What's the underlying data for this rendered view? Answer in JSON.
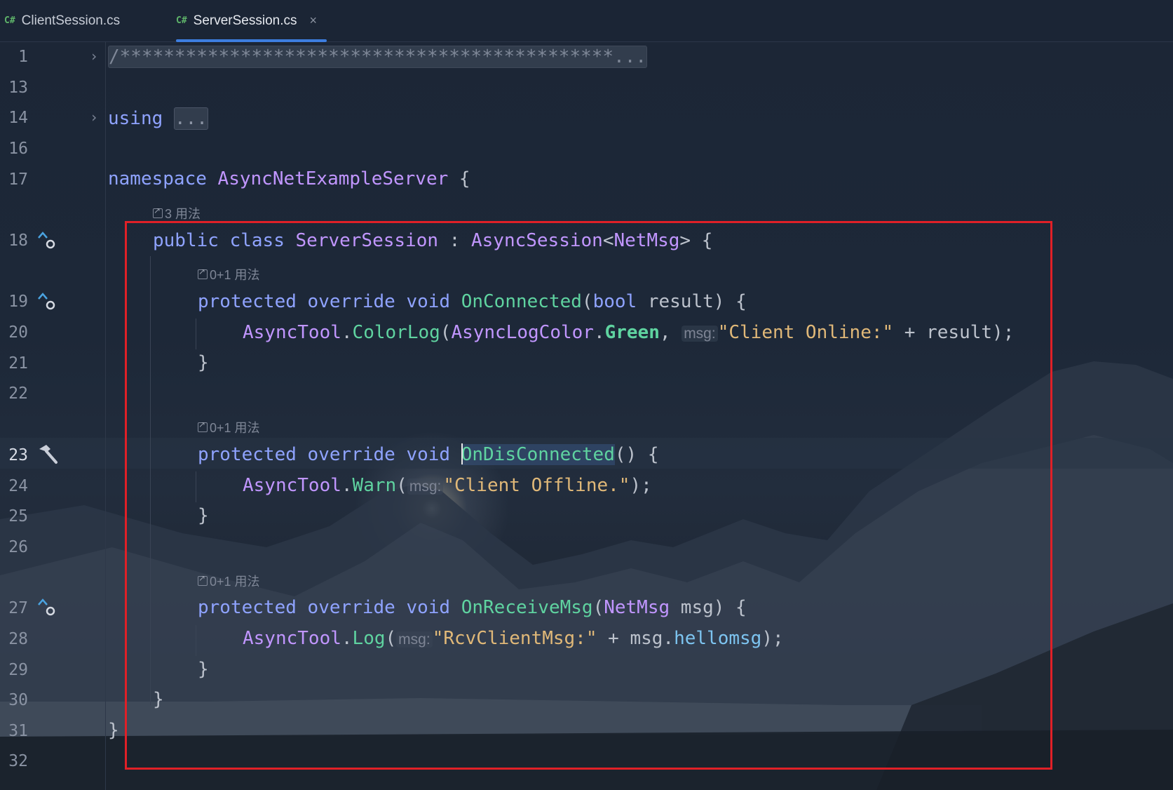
{
  "tabs": [
    {
      "icon": "C#",
      "label": "ClientSession.cs",
      "active": false
    },
    {
      "icon": "C#",
      "label": "ServerSession.cs",
      "active": true,
      "close": "×"
    }
  ],
  "line_numbers": [
    "1",
    "13",
    "14",
    "16",
    "17",
    "18",
    "19",
    "20",
    "21",
    "22",
    "23",
    "24",
    "25",
    "26",
    "27",
    "28",
    "29",
    "30",
    "31",
    "32"
  ],
  "code": {
    "l1_comment": "/*********************************************",
    "l1_fold": "...",
    "l14_using": "using",
    "l14_fold": "...",
    "l17_namespace": "namespace",
    "l17_name": "AsyncNetExampleServer",
    "l17_brace": " {",
    "usage_class": "3 用法",
    "l18_public": "public",
    "l18_class": "class",
    "l18_name": "ServerSession",
    "l18_colon": " : ",
    "l18_base": "AsyncSession",
    "l18_lt": "<",
    "l18_generic": "NetMsg",
    "l18_gt": "> {",
    "usage_onconnected": "0+1 用法",
    "l19_protected": "protected",
    "l19_override": "override",
    "l19_void": "void",
    "l19_method": "OnConnected",
    "l19_open": "(",
    "l19_bool": "bool",
    "l19_rest": " result) {",
    "l20_tool": "AsyncTool",
    "l20_dot": ".",
    "l20_method": "ColorLog",
    "l20_open": "(",
    "l20_enum": "AsyncLogColor",
    "l20_dot2": ".",
    "l20_field": "Green",
    "l20_comma": ", ",
    "l20_hint": "msg:",
    "l20_str": "\"Client Online:\"",
    "l20_rest": " + result);",
    "l21_brace": "}",
    "usage_ondisconnected": "0+1 用法",
    "l23_protected": "protected",
    "l23_override": "override",
    "l23_void": "void",
    "l23_method": "OnDisConnected",
    "l23_rest": "() {",
    "l24_tool": "AsyncTool",
    "l24_dot": ".",
    "l24_method": "Warn",
    "l24_open": "(",
    "l24_hint": "msg:",
    "l24_str": "\"Client Offline.\"",
    "l24_rest": ");",
    "l25_brace": "}",
    "usage_onreceive": "0+1 用法",
    "l27_protected": "protected",
    "l27_override": "override",
    "l27_void": "void",
    "l27_method": "OnReceiveMsg",
    "l27_open": "(",
    "l27_type": "NetMsg",
    "l27_rest": " msg) {",
    "l28_tool": "AsyncTool",
    "l28_dot": ".",
    "l28_method": "Log",
    "l28_open": "(",
    "l28_hint": "msg:",
    "l28_str": "\"RcvClientMsg:\"",
    "l28_plus": " + msg.",
    "l28_field": "hellomsg",
    "l28_rest": ");",
    "l29_brace": "}",
    "l30_brace": "}",
    "l31_brace": "}"
  },
  "gutter_icons": [
    "implements-up-icon",
    "implements-up-icon",
    "hammer-icon",
    "implements-up-icon"
  ],
  "colors": {
    "highlight_box": "#e02027",
    "tab_active_underline": "#3d7ee0",
    "keyword": "#8fa3ff",
    "class": "#c196ff",
    "method": "#5fd3a0",
    "string": "#e0b878"
  }
}
